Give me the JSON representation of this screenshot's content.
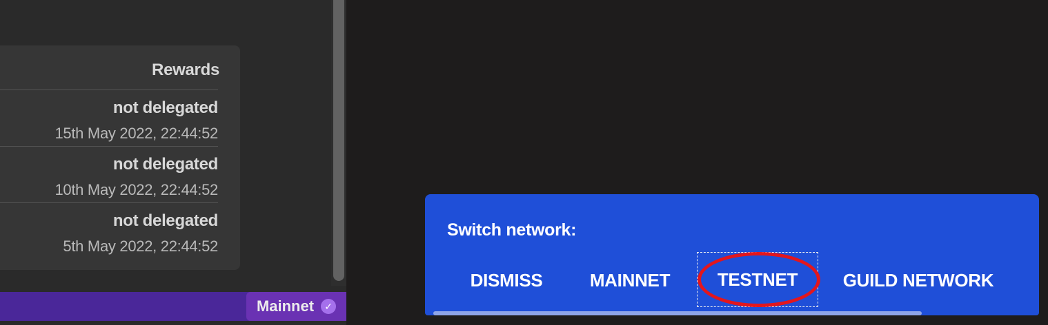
{
  "rewards": {
    "header": "Rewards",
    "rows": [
      {
        "status": "not delegated",
        "date": "15th May 2022, 22:44:52"
      },
      {
        "status": "not delegated",
        "date": "10th May 2022, 22:44:52"
      },
      {
        "status": "not delegated",
        "date": "5th May 2022, 22:44:52"
      }
    ]
  },
  "status_bar": {
    "network_label": "Mainnet",
    "icon": "check-circle-icon"
  },
  "snackbar": {
    "title": "Switch network:",
    "actions": {
      "dismiss": "DISMISS",
      "mainnet": "MAINNET",
      "testnet": "TESTNET",
      "guild": "GUILD NETWORK"
    }
  },
  "colors": {
    "snackbar_bg": "#1f4fd8",
    "network_bar": "#4a2799",
    "badge": "#6a32b3",
    "highlight": "#e3161d"
  }
}
